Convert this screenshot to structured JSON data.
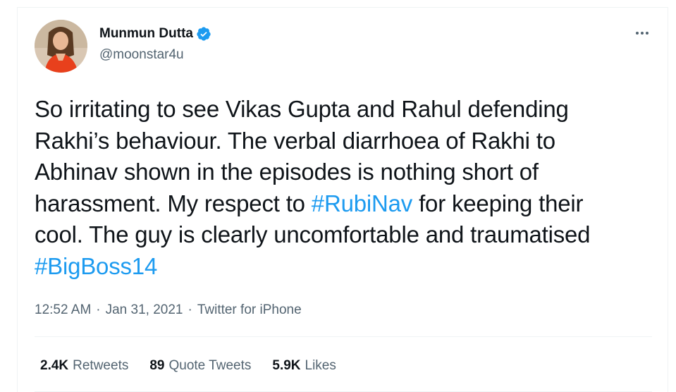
{
  "author": {
    "display_name": "Munmun Dutta",
    "handle": "@moonstar4u",
    "verified": true
  },
  "tweet": {
    "lines": [
      [
        {
          "text": "So irritating to see Vikas Gupta and Rahul defending",
          "hashtag": false
        }
      ],
      [
        {
          "text": "Rakhi’s behaviour. The verbal diarrhoea of Rakhi to",
          "hashtag": false
        }
      ],
      [
        {
          "text": "Abhinav shown in the episodes is nothing short of",
          "hashtag": false
        }
      ],
      [
        {
          "text": "harassment. My respect to ",
          "hashtag": false
        },
        {
          "text": "#RubiNav",
          "hashtag": true
        },
        {
          "text": " for keeping their",
          "hashtag": false
        }
      ],
      [
        {
          "text": "cool. The guy is clearly uncomfortable and traumatised",
          "hashtag": false
        }
      ],
      [
        {
          "text": "#BigBoss14",
          "hashtag": true
        }
      ]
    ]
  },
  "meta": {
    "time": "12:52 AM",
    "date": "Jan 31, 2021",
    "separator": "·",
    "source": "Twitter for iPhone"
  },
  "stats": {
    "retweets_count": "2.4K",
    "retweets_label": "Retweets",
    "quotes_count": "89",
    "quotes_label": "Quote Tweets",
    "likes_count": "5.9K",
    "likes_label": "Likes"
  },
  "colors": {
    "text": "#0f1419",
    "secondary": "#536471",
    "link": "#1d9bf0",
    "border": "#eff3f4"
  },
  "icons": {
    "verified": "verified-badge-icon",
    "more": "more-options-icon"
  }
}
